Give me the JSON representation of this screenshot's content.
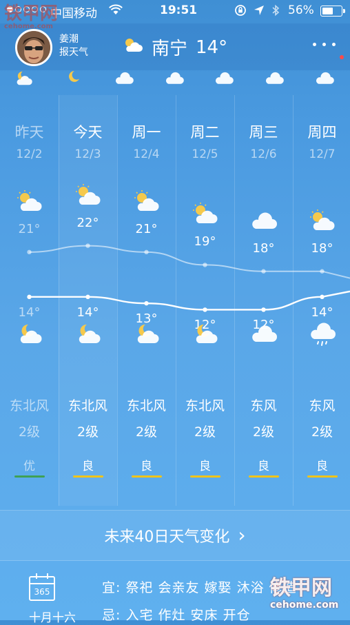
{
  "status_bar": {
    "carrier": "中国移动",
    "time": "19:51",
    "battery": "56%",
    "battery_level": 0.56,
    "signal_bars": 1
  },
  "header": {
    "anchor_name": "姜潮",
    "anchor_tagline": "报天气",
    "city": "南宁",
    "current_temp": "14°",
    "weather_icon": "partly-cloudy-day-icon",
    "notification_dot_color": "#ff4a4a"
  },
  "hourly_icons": [
    "cloudy-night-icon",
    "moon-icon",
    "cloud-icon",
    "cloud-icon",
    "cloud-icon",
    "cloud-icon",
    "cloud-icon"
  ],
  "days": [
    {
      "day": "昨天",
      "date": "12/2",
      "high": "21°",
      "low": "14°",
      "day_icon": "partly-cloudy-day-icon",
      "night_icon": "cloudy-night-icon",
      "wind_dir": "东北风",
      "wind_level": "2级",
      "aqi": "优",
      "aqi_color": "#3fa055",
      "past": true
    },
    {
      "day": "今天",
      "date": "12/3",
      "high": "22°",
      "low": "14°",
      "day_icon": "partly-cloudy-day-icon",
      "night_icon": "cloudy-night-icon",
      "wind_dir": "东北风",
      "wind_level": "2级",
      "aqi": "良",
      "aqi_color": "#f0c419",
      "past": false
    },
    {
      "day": "周一",
      "date": "12/4",
      "high": "21°",
      "low": "13°",
      "day_icon": "partly-cloudy-day-icon",
      "night_icon": "cloudy-night-icon",
      "wind_dir": "东北风",
      "wind_level": "2级",
      "aqi": "良",
      "aqi_color": "#f0c419",
      "past": false
    },
    {
      "day": "周二",
      "date": "12/5",
      "high": "19°",
      "low": "12°",
      "day_icon": "partly-cloudy-day-icon",
      "night_icon": "cloudy-night-icon",
      "wind_dir": "东北风",
      "wind_level": "2级",
      "aqi": "良",
      "aqi_color": "#f0c419",
      "past": false
    },
    {
      "day": "周三",
      "date": "12/6",
      "high": "18°",
      "low": "12°",
      "day_icon": "cloud-icon",
      "night_icon": "cloud-icon",
      "wind_dir": "东风",
      "wind_level": "2级",
      "aqi": "良",
      "aqi_color": "#f0c419",
      "past": false
    },
    {
      "day": "周四",
      "date": "12/7",
      "high": "18°",
      "low": "14°",
      "day_icon": "partly-cloudy-day-icon",
      "night_icon": "rain-cloud-icon",
      "wind_dir": "东风",
      "wind_level": "2级",
      "aqi": "良",
      "aqi_color": "#f0c419",
      "past": false
    }
  ],
  "temperature_chart": {
    "highs": [
      21,
      22,
      21,
      19,
      18,
      18
    ],
    "lows": [
      14,
      14,
      13,
      12,
      12,
      14
    ]
  },
  "forty_day": {
    "label": "未来40日天气变化",
    "chevron": "›"
  },
  "almanac": {
    "calendar_number": "365",
    "lunar_date": "十月十六",
    "good_label": "宜:",
    "good_items": "祭祀  会亲友  嫁娶  沐浴  修造",
    "bad_label": "忌:",
    "bad_items": "入宅  作灶  安床  开仓"
  },
  "watermark": {
    "text": "铁甲网",
    "sub": "cehome.com"
  }
}
